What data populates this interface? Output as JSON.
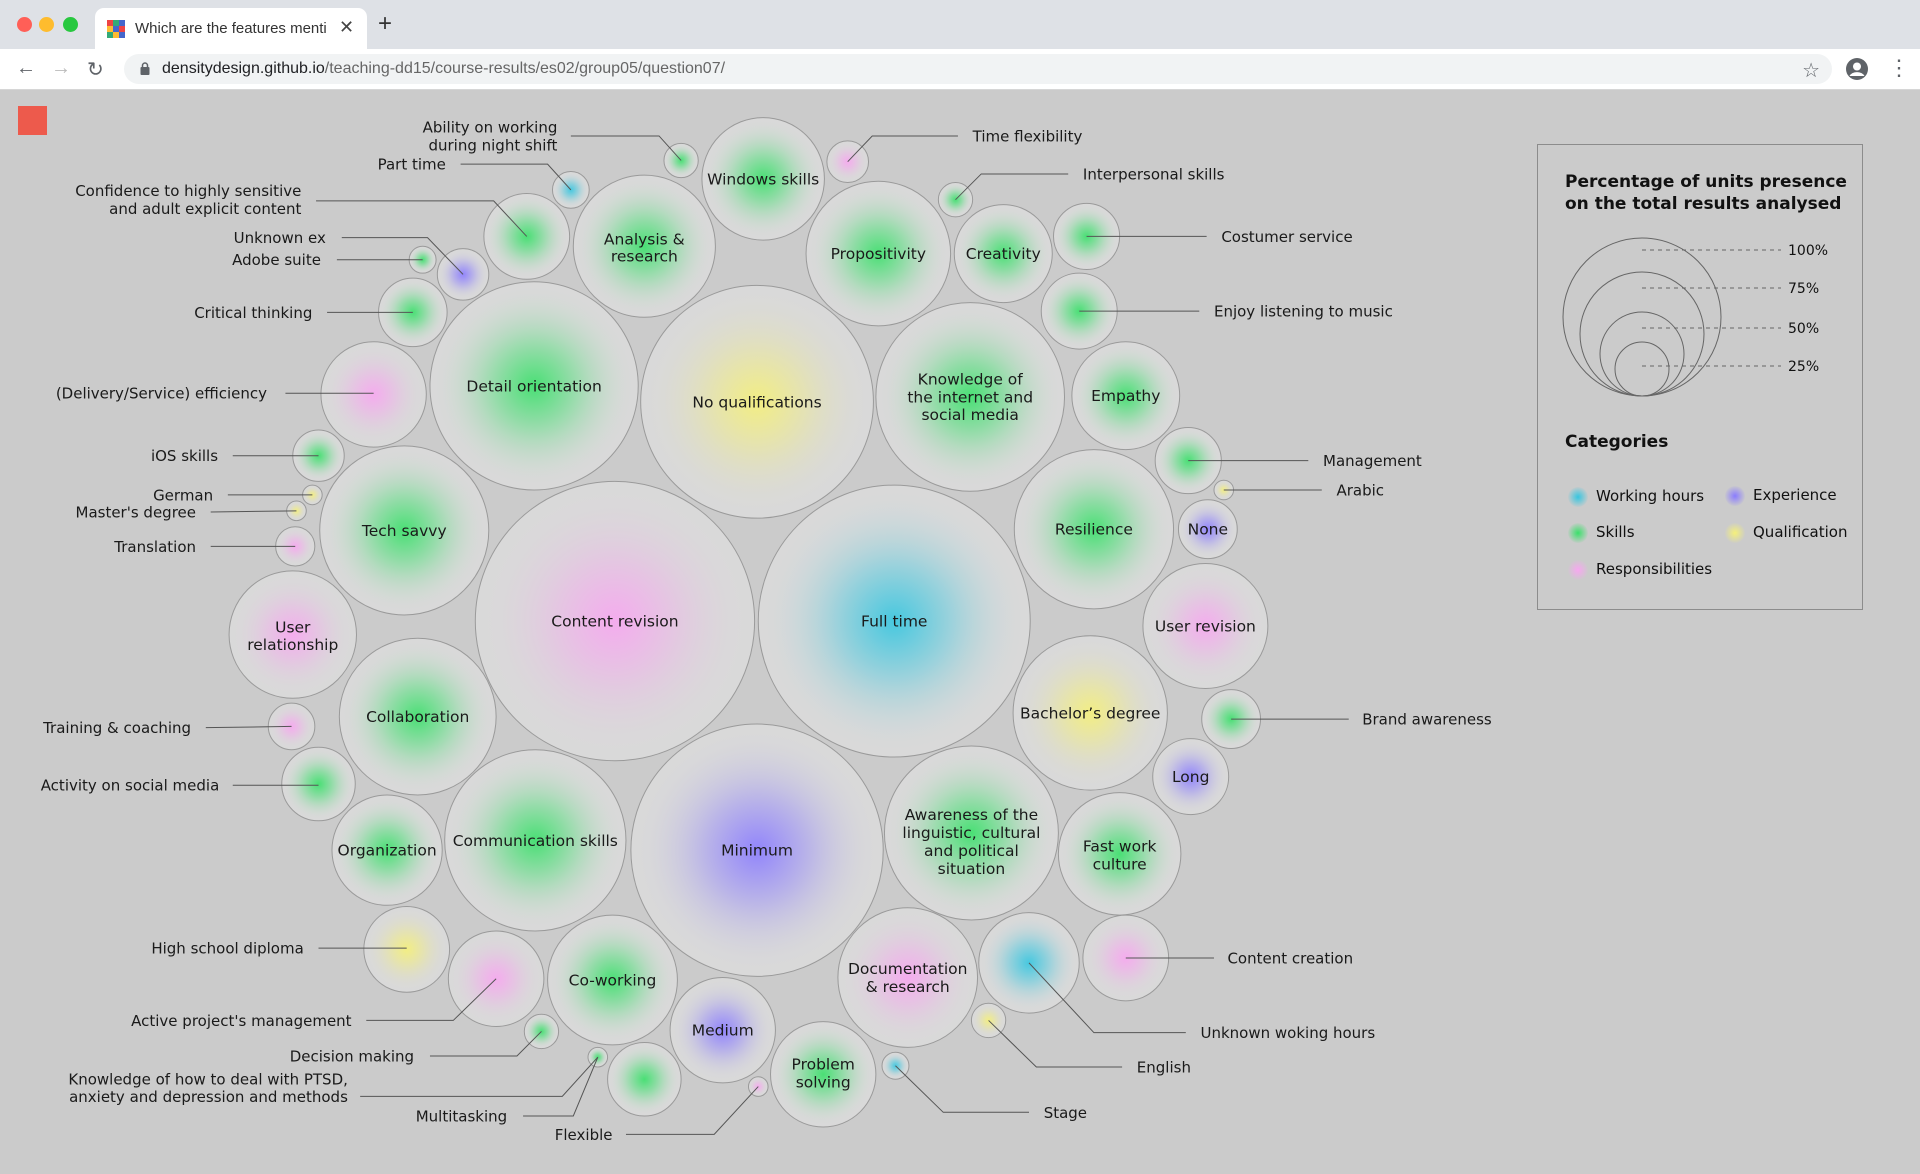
{
  "browser": {
    "tab_title": "Which are the features mentioned",
    "url_host": "densitydesign.github.io",
    "url_path": "/teaching-dd15/course-results/es02/group05/question07/"
  },
  "legend": {
    "size_title_line1": "Percentage of units presence",
    "size_title_line2": "on the total results analysed",
    "size_labels": [
      "100%",
      "75%",
      "50%",
      "25%"
    ],
    "categories_title": "Categories",
    "categories": [
      {
        "name": "Working hours",
        "color": "#37c6e0"
      },
      {
        "name": "Experience",
        "color": "#8a7cff"
      },
      {
        "name": "Skills",
        "color": "#3ae06a"
      },
      {
        "name": "Qualification",
        "color": "#f5f07a"
      },
      {
        "name": "Responsibilities",
        "color": "#f7a7f0"
      }
    ]
  },
  "chart_data": {
    "type": "bubble-pack",
    "bubbles": [
      {
        "name": "Full time",
        "category": "Working hours"
      },
      {
        "name": "Content revision",
        "category": "Responsibilities"
      },
      {
        "name": "Minimum",
        "category": "Experience"
      },
      {
        "name": "No qualifications",
        "category": "Qualification"
      },
      {
        "name": "Detail orientation",
        "category": "Skills"
      },
      {
        "name": "Knowledge of the internet and social media",
        "category": "Skills"
      },
      {
        "name": "Communication skills",
        "category": "Skills"
      },
      {
        "name": "Awareness of the linguistic, cultural and political situation",
        "category": "Skills"
      },
      {
        "name": "Tech savvy",
        "category": "Skills"
      },
      {
        "name": "Resilience",
        "category": "Skills"
      },
      {
        "name": "Collaboration",
        "category": "Skills"
      },
      {
        "name": "Bachelor's degree",
        "category": "Qualification"
      },
      {
        "name": "Propositivity",
        "category": "Skills"
      },
      {
        "name": "Analysis & research",
        "category": "Skills"
      },
      {
        "name": "Documentation & research",
        "category": "Responsibilities"
      },
      {
        "name": "Co-working",
        "category": "Skills"
      },
      {
        "name": "Windows skills",
        "category": "Skills"
      },
      {
        "name": "User relationship",
        "category": "Responsibilities"
      },
      {
        "name": "User revision",
        "category": "Responsibilities"
      },
      {
        "name": "Fast work culture",
        "category": "Skills"
      },
      {
        "name": "Organization",
        "category": "Skills"
      },
      {
        "name": "Empathy",
        "category": "Skills"
      },
      {
        "name": "Creativity",
        "category": "Skills"
      },
      {
        "name": "Problem solving",
        "category": "Skills"
      },
      {
        "name": "Medium",
        "category": "Experience"
      },
      {
        "name": "(Delivery/Service) efficiency",
        "category": "Responsibilities"
      },
      {
        "name": "Confidence to highly sensitive and adult explicit content",
        "category": "Skills"
      },
      {
        "name": "Unknown woking hours",
        "category": "Working hours"
      },
      {
        "name": "Active project's management",
        "category": "Responsibilities"
      },
      {
        "name": "Content creation",
        "category": "Responsibilities"
      },
      {
        "name": "High school diploma",
        "category": "Qualification"
      },
      {
        "name": "Costumer service",
        "category": "Skills"
      },
      {
        "name": "Enjoy listening to music",
        "category": "Skills"
      },
      {
        "name": "Critical thinking",
        "category": "Skills"
      },
      {
        "name": "Activity on social media",
        "category": "Skills"
      },
      {
        "name": "Flexible",
        "category": "Skills"
      },
      {
        "name": "None",
        "category": "Experience"
      },
      {
        "name": "Long",
        "category": "Experience"
      },
      {
        "name": "Management",
        "category": "Skills"
      },
      {
        "name": "Brand awareness",
        "category": "Skills"
      },
      {
        "name": "iOS skills",
        "category": "Skills"
      },
      {
        "name": "Unknown ex",
        "category": "Experience"
      },
      {
        "name": "Time flexibility",
        "category": "Responsibilities"
      },
      {
        "name": "Training & coaching",
        "category": "Responsibilities"
      },
      {
        "name": "Translation",
        "category": "Responsibilities"
      },
      {
        "name": "Ability on working during night shift",
        "category": "Skills"
      },
      {
        "name": "Part time",
        "category": "Working hours"
      },
      {
        "name": "Interpersonal skills",
        "category": "Skills"
      },
      {
        "name": "Decision making",
        "category": "Skills"
      },
      {
        "name": "English",
        "category": "Qualification"
      },
      {
        "name": "Stage",
        "category": "Working hours"
      },
      {
        "name": "Adobe suite",
        "category": "Skills"
      },
      {
        "name": "German",
        "category": "Qualification"
      },
      {
        "name": "Master's degree",
        "category": "Qualification"
      },
      {
        "name": "Arabic",
        "category": "Qualification"
      },
      {
        "name": "Multitasking",
        "category": "Skills"
      },
      {
        "name": "Knowledge of how to deal with PTSD, anxiety and depression and methods",
        "category": "Responsibilities"
      }
    ]
  },
  "labels": {
    "inside": [
      {
        "lines": [
          "Full time"
        ]
      },
      {
        "lines": [
          "Content revision"
        ]
      },
      {
        "lines": [
          "Minimum"
        ]
      },
      {
        "lines": [
          "No qualifications"
        ]
      },
      {
        "lines": [
          "Detail orientation"
        ]
      },
      {
        "lines": [
          "Knowledge of",
          "the internet and",
          "social media"
        ]
      },
      {
        "lines": [
          "Communication skills"
        ]
      },
      {
        "lines": [
          "Awareness of the",
          "linguistic, cultural",
          "and political",
          "situation"
        ]
      },
      {
        "lines": [
          "Tech savvy"
        ]
      },
      {
        "lines": [
          "Resilience"
        ]
      },
      {
        "lines": [
          "Collaboration"
        ]
      },
      {
        "lines": [
          "Bachelor’s degree"
        ]
      },
      {
        "lines": [
          "Propositivity"
        ]
      },
      {
        "lines": [
          "Analysis &",
          "research"
        ]
      },
      {
        "lines": [
          "Documentation",
          "& research"
        ]
      },
      {
        "lines": [
          "Co-working"
        ]
      },
      {
        "lines": [
          "Windows skills"
        ]
      },
      {
        "lines": [
          "User",
          "relationship"
        ]
      },
      {
        "lines": [
          "User revision"
        ]
      },
      {
        "lines": [
          "Fast work",
          "culture"
        ]
      },
      {
        "lines": [
          "Organization"
        ]
      },
      {
        "lines": [
          "Empathy"
        ]
      },
      {
        "lines": [
          "Creativity"
        ]
      },
      {
        "lines": [
          "Problem",
          "solving"
        ]
      },
      {
        "lines": [
          "Medium"
        ]
      },
      {
        "lines": [
          "None"
        ]
      },
      {
        "lines": [
          "Long"
        ]
      }
    ],
    "outside": [
      {
        "lines": [
          "(Delivery/Service) efficiency"
        ]
      },
      {
        "lines": [
          "Confidence to highly sensitive",
          "and adult explicit content"
        ]
      },
      {
        "lines": [
          "Unknown woking hours"
        ]
      },
      {
        "lines": [
          "Active project's management"
        ]
      },
      {
        "lines": [
          "Content creation"
        ]
      },
      {
        "lines": [
          "High school diploma"
        ]
      },
      {
        "lines": [
          "Costumer service"
        ]
      },
      {
        "lines": [
          "Enjoy listening to music"
        ]
      },
      {
        "lines": [
          "Critical thinking"
        ]
      },
      {
        "lines": [
          "Activity on social media"
        ]
      },
      {
        "lines": [
          "Flexible"
        ]
      },
      {
        "lines": [
          "Management"
        ]
      },
      {
        "lines": [
          "Brand awareness"
        ]
      },
      {
        "lines": [
          "iOS skills"
        ]
      },
      {
        "lines": [
          "Unknown ex"
        ]
      },
      {
        "lines": [
          "Time flexibility"
        ]
      },
      {
        "lines": [
          "Training & coaching"
        ]
      },
      {
        "lines": [
          "Translation"
        ]
      },
      {
        "lines": [
          "Ability on working",
          "during night shift"
        ]
      },
      {
        "lines": [
          "Part time"
        ]
      },
      {
        "lines": [
          "Interpersonal skills"
        ]
      },
      {
        "lines": [
          "Decision making"
        ]
      },
      {
        "lines": [
          "English"
        ]
      },
      {
        "lines": [
          "Stage"
        ]
      },
      {
        "lines": [
          "Adobe suite"
        ]
      },
      {
        "lines": [
          "German"
        ]
      },
      {
        "lines": [
          "Master's degree"
        ]
      },
      {
        "lines": [
          "Arabic"
        ]
      },
      {
        "lines": [
          "Multitasking"
        ]
      },
      {
        "lines": [
          "Knowledge of how to deal with PTSD,",
          "anxiety and depression and methods"
        ]
      }
    ]
  }
}
